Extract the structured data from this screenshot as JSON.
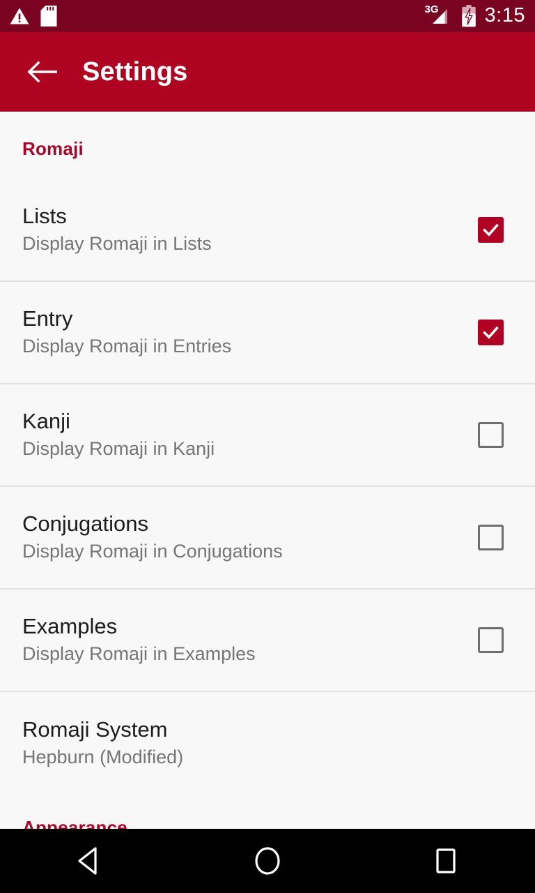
{
  "status_bar": {
    "icons": [
      "warning-icon",
      "sdcard-icon"
    ],
    "network_type": "3G",
    "signal_icon": "signal-bars-icon",
    "battery_icon": "battery-charging-icon",
    "time": "3:15",
    "background_color": "#7B0322"
  },
  "app_bar": {
    "back_icon": "back-arrow-icon",
    "title": "Settings",
    "background_color": "#AF0421",
    "text_color": "#FFFFFF"
  },
  "theme": {
    "accent_color": "#A5072B",
    "checkbox_checked_color": "#B00024",
    "checkbox_unchecked_color": "#6E6E6E",
    "page_background": "#F8F8F8",
    "divider_color": "#E0E0E0",
    "title_color": "#1C1C1C",
    "summary_color": "#757575"
  },
  "sections": [
    {
      "header": "Romaji",
      "items": [
        {
          "title": "Lists",
          "summary": "Display Romaji in Lists",
          "checked": true
        },
        {
          "title": "Entry",
          "summary": "Display Romaji in Entries",
          "checked": true
        },
        {
          "title": "Kanji",
          "summary": "Display Romaji in Kanji",
          "checked": false
        },
        {
          "title": "Conjugations",
          "summary": "Display Romaji in Conjugations",
          "checked": false
        },
        {
          "title": "Examples",
          "summary": "Display Romaji in Examples",
          "checked": false
        },
        {
          "title": "Romaji System",
          "summary": "Hepburn (Modified)",
          "checked": null
        }
      ]
    },
    {
      "header": "Appearance",
      "items": []
    }
  ],
  "nav_bar": {
    "back_label": "back-triangle-icon",
    "home_label": "home-circle-icon",
    "recents_label": "recents-square-icon",
    "background_color": "#000000"
  }
}
